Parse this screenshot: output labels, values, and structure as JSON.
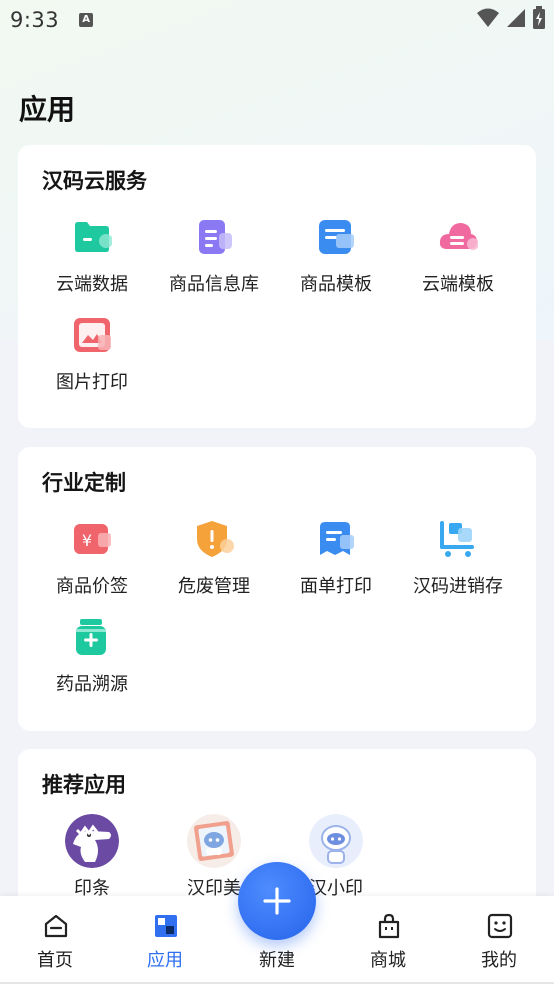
{
  "status_bar": {
    "time": "9:33",
    "notification_letter": "A"
  },
  "page": {
    "title": "应用"
  },
  "sections": [
    {
      "title": "汉码云服务",
      "items": [
        {
          "label": "云端数据",
          "icon": "folder-icon",
          "color": "#1ec9a0"
        },
        {
          "label": "商品信息库",
          "icon": "document-stack-icon",
          "color": "#8a79f3"
        },
        {
          "label": "商品模板",
          "icon": "template-icon",
          "color": "#3a8cf0"
        },
        {
          "label": "云端模板",
          "icon": "cloud-icon",
          "color": "#f06aa0"
        },
        {
          "label": "图片打印",
          "icon": "image-print-icon",
          "color": "#f0646b"
        }
      ]
    },
    {
      "title": "行业定制",
      "items": [
        {
          "label": "商品价签",
          "icon": "price-tag-icon",
          "color": "#f0646b"
        },
        {
          "label": "危废管理",
          "icon": "warning-shield-icon",
          "color": "#f5a23a"
        },
        {
          "label": "面单打印",
          "icon": "waybill-icon",
          "color": "#3a8cf0"
        },
        {
          "label": "汉码进销存",
          "icon": "inventory-cart-icon",
          "color": "#38a8f0"
        },
        {
          "label": "药品溯源",
          "icon": "medicine-bottle-icon",
          "color": "#1ec9a0"
        }
      ]
    },
    {
      "title": "推荐应用",
      "items": [
        {
          "label": "印条",
          "icon": "crocodile-avatar-icon"
        },
        {
          "label": "汉印美",
          "icon": "robot-frame-avatar-icon"
        },
        {
          "label": "汉小印",
          "icon": "robot-avatar-icon"
        }
      ]
    }
  ],
  "bottom_nav": {
    "items": [
      {
        "label": "首页",
        "icon": "home-icon",
        "active": false
      },
      {
        "label": "应用",
        "icon": "apps-icon",
        "active": true
      },
      {
        "label": "新建",
        "icon": "plus-icon",
        "active": false
      },
      {
        "label": "商城",
        "icon": "shopping-bag-icon",
        "active": false
      },
      {
        "label": "我的",
        "icon": "smile-face-icon",
        "active": false
      }
    ]
  },
  "colors": {
    "accent": "#2f6ff0",
    "fab": "#2f6ff0"
  }
}
